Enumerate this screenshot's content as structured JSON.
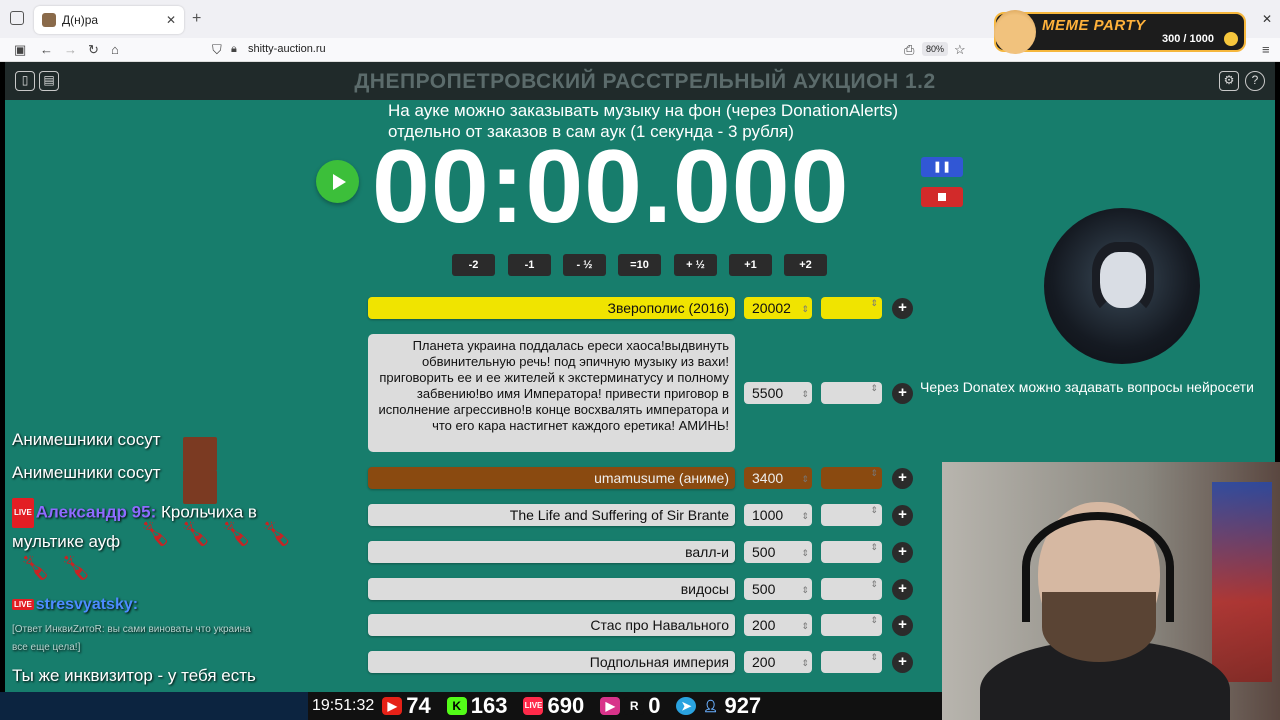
{
  "browser": {
    "tab_title": "Д(н)ра",
    "url": "shitty-auction.ru",
    "zoom": "80%"
  },
  "overlay": {
    "meme_title": "MEME PARTY",
    "meme_score": "300 / 1000"
  },
  "app": {
    "title": "ДНЕПРОПЕТРОВСКИЙ РАССТРЕЛЬНЫЙ АУКЦИОН 1.2",
    "notice_line1": "На ауке можно заказывать музыку на фон (через DonationAlerts)",
    "notice_line2": "отдельно от заказов в сам аук (1 секунда - 3 рубля)",
    "timer": "00:00.000",
    "adjust_buttons": [
      "-2",
      "-1",
      "- ½",
      "=10",
      "+ ½",
      "+1",
      "+2"
    ],
    "lots": [
      {
        "name": "Зверополис (2016)",
        "amount": "20002",
        "color": "#f0e400"
      },
      {
        "name": "Планета украина поддалась ереси хаоса!выдвинуть обвинительную речь! под эпичную музыку из вахи! приговорить ее и ее жителей к экстерминатусу и полному забвению!во имя Императора! привести приговор в исполнение агрессивно!в конце восхвалять императора и что его кара настигнет каждого еретика! АМИНЬ!",
        "amount": "5500",
        "color": "#dcdcdc"
      },
      {
        "name": "umamusume (аниме)",
        "amount": "3400",
        "color": "#8a4a10"
      },
      {
        "name": "The Life and Suffering of Sir Brante",
        "amount": "1000",
        "color": "#dcdcdc"
      },
      {
        "name": "валл-и",
        "amount": "500",
        "color": "#dcdcdc"
      },
      {
        "name": "видосы",
        "amount": "500",
        "color": "#dcdcdc"
      },
      {
        "name": "Стас про Навального",
        "amount": "200",
        "color": "#dcdcdc"
      },
      {
        "name": "Подпольная империя",
        "amount": "200",
        "color": "#dcdcdc"
      }
    ],
    "plus_label": "+",
    "donatex_text": "Через Donatex можно задавать вопросы нейросети"
  },
  "chat": {
    "m1": "Анимешники сосут",
    "m2": "Анимешники сосут",
    "live_badge": "LIVE",
    "m3_user": "Александр 95:",
    "m3_text": "Крольчиха в мультике ауф",
    "m4_user": "stresvyatsky:",
    "m5_reply": "[Ответ ИнквиZитоR: вы сами виноваты что украина все еще цела!]",
    "m6": "Ты же инквизитор - у тебя есть полномочия"
  },
  "stats": {
    "time": "19:51:32",
    "youtube": "74",
    "kick": "163",
    "vk": "690",
    "rutube": "0",
    "telegram": "927"
  }
}
